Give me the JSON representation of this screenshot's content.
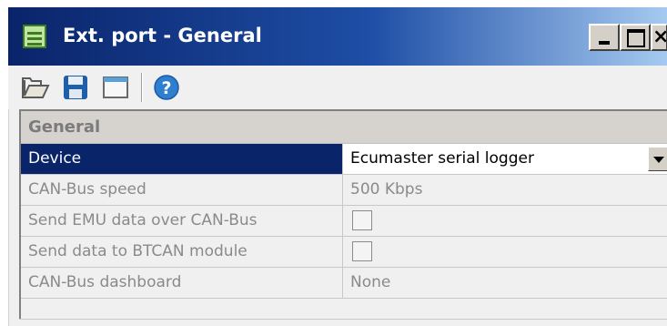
{
  "window": {
    "title": "Ext. port - General",
    "close_glyph": "×",
    "accent": "#0a246a"
  },
  "toolbar": {
    "buttons": [
      {
        "name": "open-folder-icon"
      },
      {
        "name": "save-icon"
      },
      {
        "name": "window-icon"
      },
      {
        "name": "help-icon",
        "glyph": "?"
      }
    ]
  },
  "grid": {
    "category": "General",
    "rows": [
      {
        "label": "Device",
        "value": "Ecumaster serial logger",
        "type": "dropdown",
        "selected": true
      },
      {
        "label": "CAN-Bus speed",
        "value": "500 Kbps",
        "type": "text"
      },
      {
        "label": "Send EMU data over CAN-Bus",
        "value": false,
        "type": "checkbox"
      },
      {
        "label": "Send data to BTCAN module",
        "value": false,
        "type": "checkbox"
      },
      {
        "label": "CAN-Bus dashboard",
        "value": "None",
        "type": "text"
      }
    ]
  }
}
